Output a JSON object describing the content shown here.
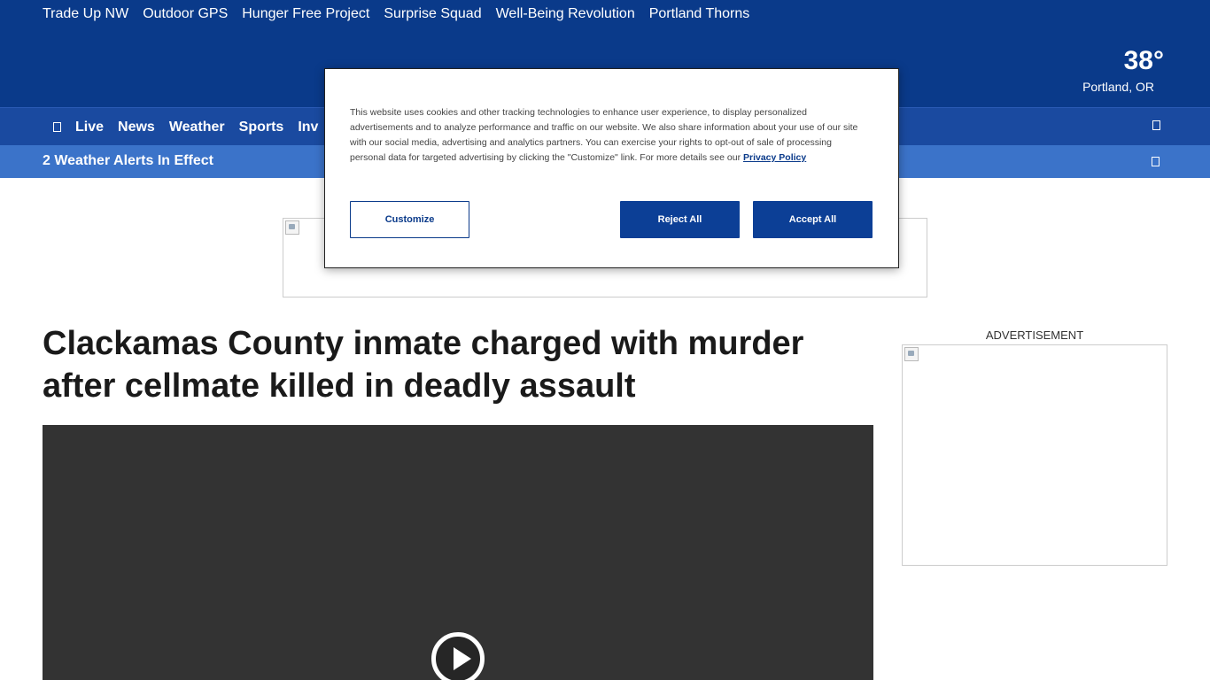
{
  "top_links": [
    "Trade Up NW",
    "Outdoor GPS",
    "Hunger Free Project",
    "Surprise Squad",
    "Well-Being Revolution",
    "Portland Thorns"
  ],
  "weather": {
    "temp": "38°",
    "city": "Portland, OR"
  },
  "nav": {
    "items": [
      "Live",
      "News",
      "Weather",
      "Sports",
      "Inv"
    ]
  },
  "alert": {
    "text": "2 Weather Alerts In Effect"
  },
  "ads": {
    "side_label": "ADVERTISEMENT"
  },
  "article": {
    "headline": "Clackamas County inmate charged with murder after cellmate killed in deadly assault"
  },
  "cookie": {
    "text": "This website uses cookies and other tracking technologies to enhance user experience, to display personalized advertisements and to analyze performance and traffic on our website. We also share information about your use of our site with our social media, advertising and analytics partners. You can exercise your rights to opt-out of sale of processing personal data for targeted advertising by clicking the \"Customize\" link. For more details see our ",
    "privacy_link": "Privacy Policy",
    "customize_label": "Customize",
    "reject_label": "Reject All",
    "accept_label": "Accept All"
  },
  "colors": {
    "header": "#0a3a8a",
    "nav": "#1a4aa0",
    "alert": "#3b73c9",
    "button": "#0c3f96"
  }
}
